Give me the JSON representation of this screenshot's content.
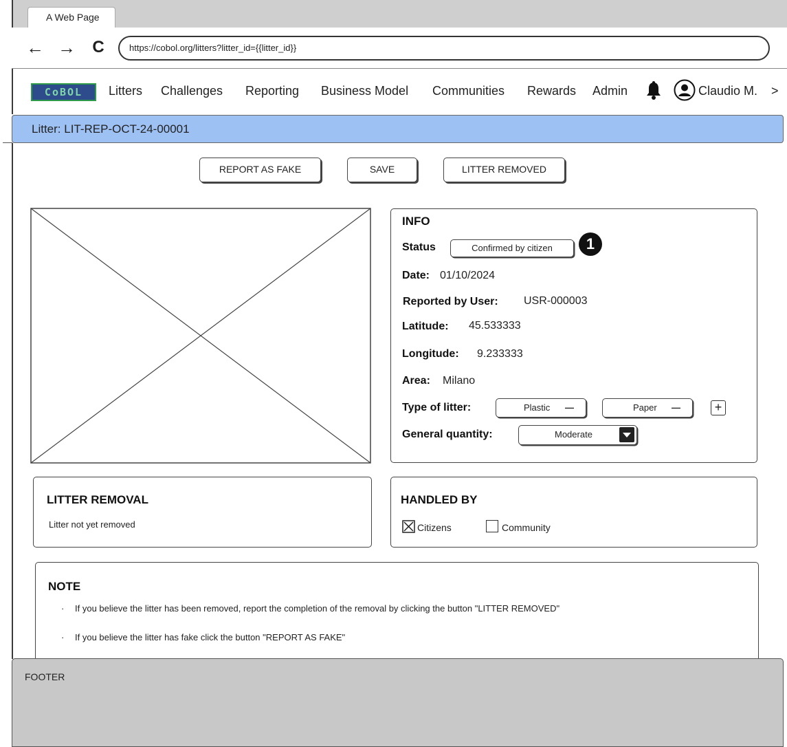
{
  "browser": {
    "tab_title": "A Web Page",
    "url": "https://cobol.org/litters?litter_id={{litter_id}}",
    "back_glyph": "←",
    "forward_glyph": "→",
    "reload_glyph": "C"
  },
  "header": {
    "logo_text": "CoBOL",
    "nav": [
      "Litters",
      "Challenges",
      "Reporting",
      "Business Model",
      "Communities",
      "Rewards",
      "Admin"
    ],
    "user_name": "Claudio M.",
    "user_chevron": ">",
    "icons": [
      "bell-icon",
      "user-avatar-icon"
    ]
  },
  "page": {
    "title": "Litter: LIT-REP-OCT-24-00001"
  },
  "actions": {
    "report_fake": "REPORT AS FAKE",
    "save": "SAVE",
    "litter_removed": "LITTER REMOVED"
  },
  "info": {
    "title": "INFO",
    "status_label": "Status",
    "status_value": "Confirmed by citizen",
    "marker": "1",
    "date_label": "Date:",
    "date_value": "01/10/2024",
    "reported_by_label": "Reported by User:",
    "reported_by_value": "USR-000003",
    "latitude_label": "Latitude:",
    "latitude_value": "45.533333",
    "longitude_label": "Longitude:",
    "longitude_value": "9.233333",
    "area_label": "Area:",
    "area_value": "Milano",
    "type_label": "Type of litter:",
    "types": [
      "Plastic",
      "Paper"
    ],
    "remove_glyph": "—",
    "add_glyph": "+",
    "quantity_label": "General quantity:",
    "quantity_value": "Moderate"
  },
  "removal": {
    "title": "LITTER REMOVAL",
    "text": "Litter not yet removed"
  },
  "handled_by": {
    "title": "HANDLED BY",
    "options": [
      {
        "label": "Citizens",
        "checked": true
      },
      {
        "label": "Community",
        "checked": false
      }
    ]
  },
  "note": {
    "title": "NOTE",
    "bullet": "·",
    "lines": [
      "If you believe the litter has been removed, report the completion of the removal by clicking the button \"LITTER REMOVED\"",
      "If you believe the litter has fake click the button \"REPORT AS FAKE\""
    ]
  },
  "footer": {
    "text": "FOOTER"
  },
  "colors": {
    "title_bar": "#9ec1f4",
    "browser_chrome": "#cfcfcf",
    "footer": "#c8c8c8",
    "logo_bg": "#2e4b8c",
    "logo_text": "#7fd6a7"
  }
}
